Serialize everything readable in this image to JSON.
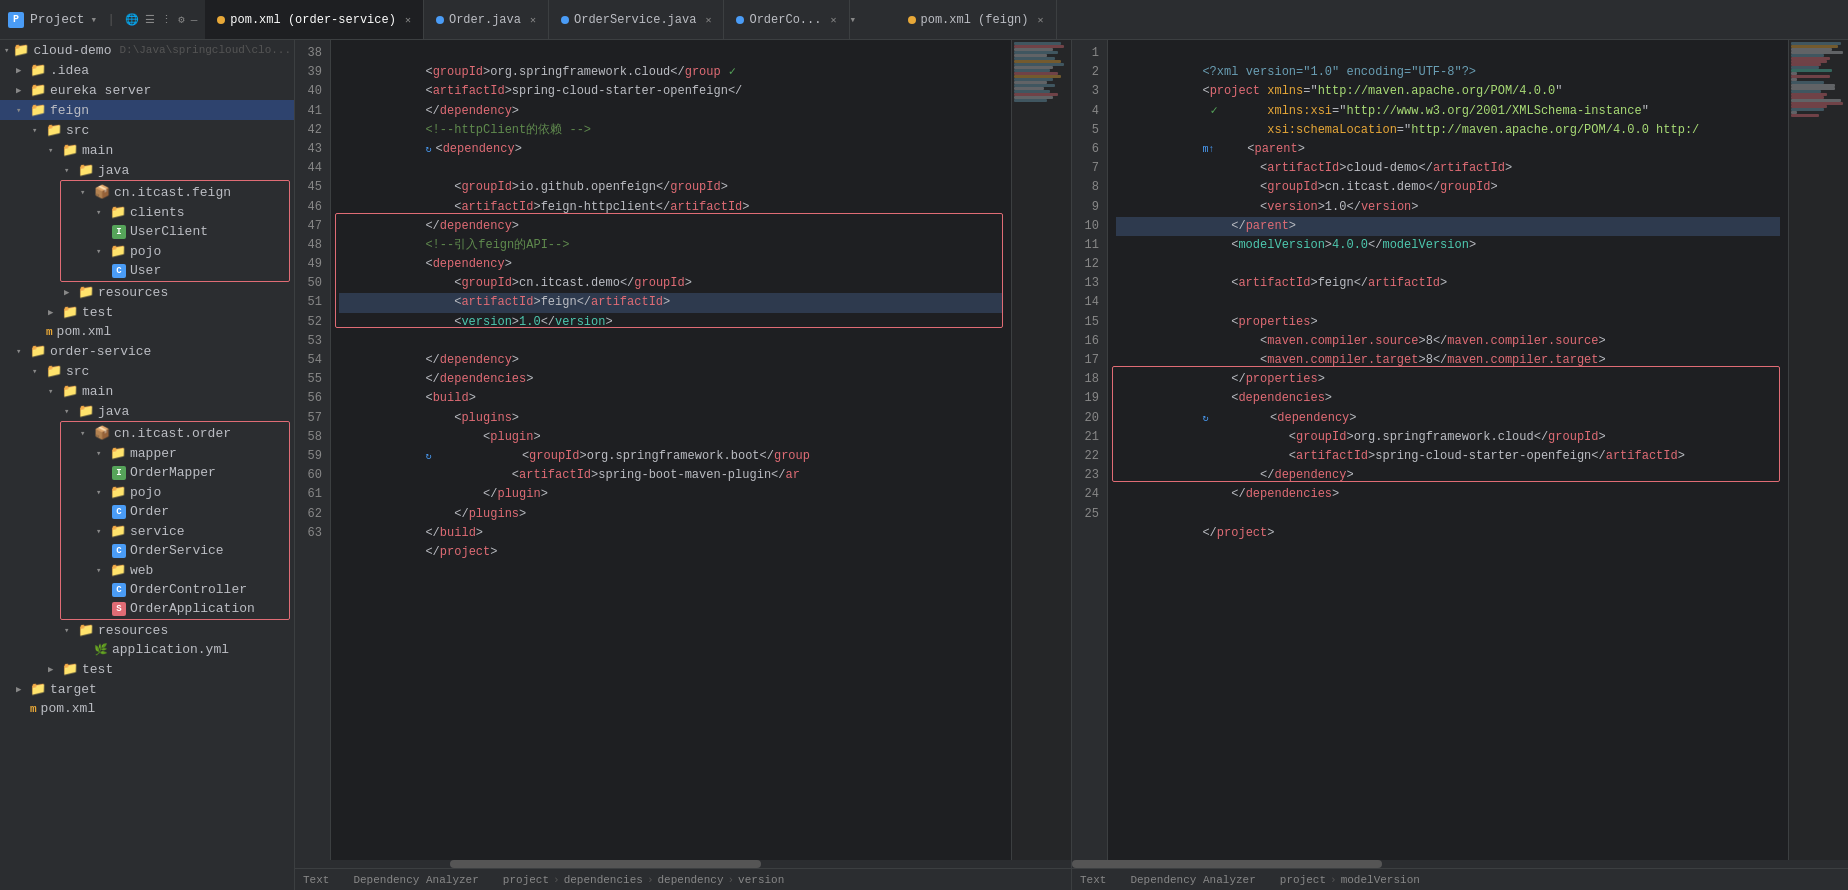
{
  "titleBar": {
    "projectLabel": "Project",
    "projectPath": "cloud-demo D:\\Java\\springcloud\\clo..."
  },
  "tabs": [
    {
      "id": "pom-order",
      "label": "pom.xml (order-service)",
      "type": "xml",
      "active": true
    },
    {
      "id": "order-java",
      "label": "Order.java",
      "type": "java",
      "active": false
    },
    {
      "id": "orderservice-java",
      "label": "OrderService.java",
      "type": "java",
      "active": false
    },
    {
      "id": "orderco-java",
      "label": "OrderCo...",
      "type": "java",
      "active": false
    },
    {
      "id": "pom-feign",
      "label": "pom.xml (feign)",
      "type": "xml",
      "active": false
    }
  ],
  "sidebar": {
    "items": [
      {
        "id": "cloud-demo",
        "label": "cloud-demo",
        "level": 0,
        "type": "folder",
        "expanded": true
      },
      {
        "id": "idea",
        "label": ".idea",
        "level": 1,
        "type": "folder",
        "expanded": false
      },
      {
        "id": "eureka-server",
        "label": "eureka server",
        "level": 1,
        "type": "folder",
        "expanded": false
      },
      {
        "id": "feign",
        "label": "feign",
        "level": 1,
        "type": "folder",
        "expanded": true,
        "selected": true
      },
      {
        "id": "src-feign",
        "label": "src",
        "level": 2,
        "type": "folder",
        "expanded": true
      },
      {
        "id": "main-feign",
        "label": "main",
        "level": 3,
        "type": "folder",
        "expanded": true
      },
      {
        "id": "java-feign",
        "label": "java",
        "level": 4,
        "type": "folder",
        "expanded": true
      },
      {
        "id": "cn-itcast-feign",
        "label": "cn.itcast.feign",
        "level": 5,
        "type": "package",
        "expanded": true
      },
      {
        "id": "clients",
        "label": "clients",
        "level": 6,
        "type": "folder",
        "expanded": true
      },
      {
        "id": "userclient",
        "label": "UserClient",
        "level": 7,
        "type": "interface"
      },
      {
        "id": "pojo-feign",
        "label": "pojo",
        "level": 6,
        "type": "folder",
        "expanded": true
      },
      {
        "id": "user",
        "label": "User",
        "level": 7,
        "type": "class"
      },
      {
        "id": "resources-feign",
        "label": "resources",
        "level": 4,
        "type": "folder",
        "expanded": false
      },
      {
        "id": "test-feign",
        "label": "test",
        "level": 3,
        "type": "folder",
        "expanded": false
      },
      {
        "id": "pom-feign-file",
        "label": "pom.xml",
        "level": 2,
        "type": "xml-file"
      },
      {
        "id": "order-service",
        "label": "order-service",
        "level": 1,
        "type": "folder",
        "expanded": true
      },
      {
        "id": "src-order",
        "label": "src",
        "level": 2,
        "type": "folder",
        "expanded": true
      },
      {
        "id": "main-order",
        "label": "main",
        "level": 3,
        "type": "folder",
        "expanded": true
      },
      {
        "id": "java-order",
        "label": "java",
        "level": 4,
        "type": "folder",
        "expanded": true
      },
      {
        "id": "cn-itcast-order",
        "label": "cn.itcast.order",
        "level": 5,
        "type": "package",
        "expanded": true
      },
      {
        "id": "mapper",
        "label": "mapper",
        "level": 6,
        "type": "folder",
        "expanded": true
      },
      {
        "id": "ordermapper",
        "label": "OrderMapper",
        "level": 7,
        "type": "interface"
      },
      {
        "id": "pojo-order",
        "label": "pojo",
        "level": 6,
        "type": "folder",
        "expanded": true
      },
      {
        "id": "order-class",
        "label": "Order",
        "level": 7,
        "type": "class"
      },
      {
        "id": "service",
        "label": "service",
        "level": 6,
        "type": "folder",
        "expanded": true
      },
      {
        "id": "orderservice-class",
        "label": "OrderService",
        "level": 7,
        "type": "class"
      },
      {
        "id": "web",
        "label": "web",
        "level": 6,
        "type": "folder",
        "expanded": true
      },
      {
        "id": "ordercontroller",
        "label": "OrderController",
        "level": 7,
        "type": "class"
      },
      {
        "id": "orderapplication",
        "label": "OrderApplication",
        "level": 7,
        "type": "spring"
      },
      {
        "id": "resources-order",
        "label": "resources",
        "level": 4,
        "type": "folder",
        "expanded": true
      },
      {
        "id": "application-yaml",
        "label": "application.yml",
        "level": 5,
        "type": "yaml-file"
      },
      {
        "id": "test-order",
        "label": "test",
        "level": 3,
        "type": "folder",
        "expanded": false
      },
      {
        "id": "target",
        "label": "target",
        "level": 1,
        "type": "folder",
        "expanded": false
      },
      {
        "id": "pom-order-file",
        "label": "pom.xml",
        "level": 1,
        "type": "xml-file"
      }
    ]
  },
  "leftEditor": {
    "lines": [
      {
        "num": 38,
        "content": "    <groupId>org.springframework.cloud</group",
        "check": true
      },
      {
        "num": 39,
        "content": "    <artifactId>spring-cloud-starter-openfeign</"
      },
      {
        "num": 40,
        "content": "</dependency>"
      },
      {
        "num": 41,
        "content": "<!--httpClient的依赖 -->"
      },
      {
        "num": 42,
        "content": "<dependency>",
        "icon": "refresh"
      },
      {
        "num": 43,
        "content": ""
      },
      {
        "num": 44,
        "content": "    <groupId>io.github.openfeign</groupId>"
      },
      {
        "num": 45,
        "content": "    <artifactId>feign-httpclient</artifactId>"
      },
      {
        "num": 46,
        "content": "</dependency>"
      },
      {
        "num": 47,
        "content": "<!--引入feign的API-->"
      },
      {
        "num": 48,
        "content": "<dependency>"
      },
      {
        "num": 49,
        "content": "    <groupId>cn.itcast.demo</groupId>"
      },
      {
        "num": 50,
        "content": "    <artifactId>feign</artifactId>"
      },
      {
        "num": 51,
        "content": "    <version>1.0</version>"
      },
      {
        "num": 52,
        "content": ""
      },
      {
        "num": 53,
        "content": "</dependency>"
      },
      {
        "num": 54,
        "content": "</dependencies>"
      },
      {
        "num": 55,
        "content": "<build>"
      },
      {
        "num": 56,
        "content": "    <plugins>"
      },
      {
        "num": 57,
        "content": "        <plugin>"
      },
      {
        "num": 58,
        "content": "            <groupId>org.springframework.boot</group",
        "icon": "refresh"
      },
      {
        "num": 59,
        "content": "            <artifactId>spring-boot-maven-plugin</ar"
      },
      {
        "num": 60,
        "content": "        </plugin>"
      },
      {
        "num": 61,
        "content": "    </plugins>"
      },
      {
        "num": 62,
        "content": "</build>"
      },
      {
        "num": 63,
        "content": "</project>"
      }
    ],
    "breadcrumb": [
      "project",
      "dependencies",
      "dependency",
      "version"
    ]
  },
  "rightEditor": {
    "lines": [
      {
        "num": 1,
        "content": "<?xml version=\"1.0\" encoding=\"UTF-8\"?>"
      },
      {
        "num": 2,
        "content": "<project xmlns=\"http://maven.apache.org/POM/4.0.0\"",
        "check": true
      },
      {
        "num": 3,
        "content": "         xmlns:xsi=\"http://www.w3.org/2001/XMLSchema-instance\""
      },
      {
        "num": 4,
        "content": "         xsi:schemaLocation=\"http://maven.apache.org/POM/4.0.0 http:/"
      },
      {
        "num": 5,
        "content": "    <parent>",
        "bluem": true
      },
      {
        "num": 6,
        "content": "        <artifactId>cloud-demo</artifactId>"
      },
      {
        "num": 7,
        "content": "        <groupId>cn.itcast.demo</groupId>"
      },
      {
        "num": 8,
        "content": "        <version>1.0</version>"
      },
      {
        "num": 9,
        "content": "    </parent>"
      },
      {
        "num": 10,
        "content": "    <modelVersion>4.0.0</modelVersion>",
        "highlight": true
      },
      {
        "num": 11,
        "content": ""
      },
      {
        "num": 12,
        "content": "    <artifactId>feign</artifactId>"
      },
      {
        "num": 13,
        "content": ""
      },
      {
        "num": 14,
        "content": "    <properties>"
      },
      {
        "num": 15,
        "content": "        <maven.compiler.source>8</maven.compiler.source>"
      },
      {
        "num": 16,
        "content": "        <maven.compiler.target>8</maven.compiler.target>"
      },
      {
        "num": 17,
        "content": "    </properties>"
      },
      {
        "num": 18,
        "content": "    <dependencies>"
      },
      {
        "num": 19,
        "content": "        <dependency>",
        "icon": "refresh"
      },
      {
        "num": 20,
        "content": "            <groupId>org.springframework.cloud</groupId>"
      },
      {
        "num": 21,
        "content": "            <artifactId>spring-cloud-starter-openfeign</artifactId>"
      },
      {
        "num": 22,
        "content": "        </dependency>"
      },
      {
        "num": 23,
        "content": "    </dependencies>"
      },
      {
        "num": 24,
        "content": ""
      },
      {
        "num": 25,
        "content": "</project>"
      }
    ],
    "breadcrumb": [
      "project",
      "modelVersion"
    ]
  },
  "statusBar": {
    "leftLabel": "Text",
    "bottomLabel1": "Dependency Analyzer",
    "rightLabel": "Text",
    "bottomLabel2": "Dependency Analyzer"
  },
  "colors": {
    "xmlTag": "#e06c75",
    "xmlText": "#bcbec4",
    "xmlComment": "#608b4e",
    "xmlValue": "#ce9178",
    "redBox": "#e06c75",
    "greenCheck": "#56a45a",
    "background": "#1e1f22"
  }
}
